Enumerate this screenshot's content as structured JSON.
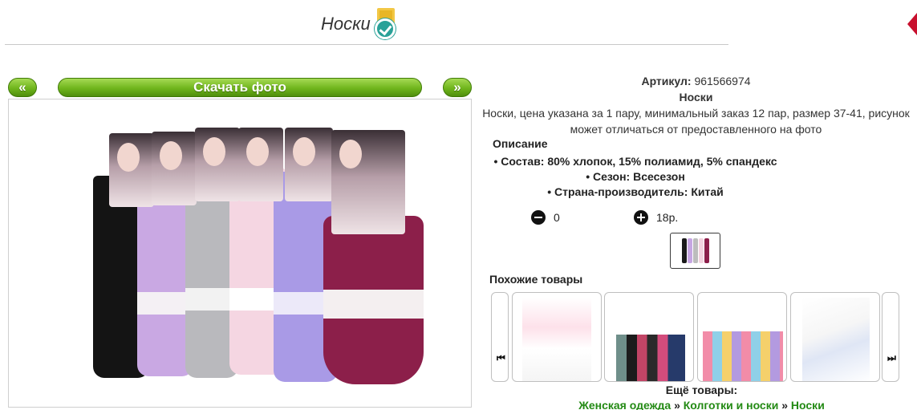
{
  "header": {
    "title": "Носки"
  },
  "nav": {
    "prev_label": "«",
    "download_label": "Скачать фото",
    "next_label": "»"
  },
  "product": {
    "sku_label": "Артикул:",
    "sku_value": "961566974",
    "name": "Носки",
    "description": "Носки, цена указана за 1 пару, минимальный заказ 12 пар, размер 37-41, рисунок может отличаться от предоставленного на фото",
    "description_heading": "Описание",
    "features": [
      "Состав: 80% хлопок, 15% полиамид, 5% спандекс",
      "Сезон: Всесезон",
      "Страна-производитель: Китай"
    ],
    "quantity": "0",
    "price": "18р."
  },
  "similar": {
    "heading": "Похожие товары",
    "items": [
      "white-pink-socks",
      "colorful-socks-pack",
      "multicolor-socks-box",
      "white-blue-stripe-socks"
    ]
  },
  "more": {
    "heading": "Ещё товары:",
    "crumb_1": "Женская одежда",
    "crumb_2": "Колготки и носки",
    "crumb_3": "Носки",
    "sep": "»"
  },
  "colors": {
    "accent_green": "#6fb51c",
    "link_green": "#238a14",
    "badge_teal": "#2aa198"
  }
}
